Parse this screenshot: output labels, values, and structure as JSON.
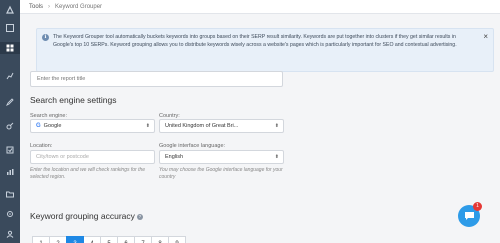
{
  "breadcrumb": {
    "root": "Tools",
    "separator": "›",
    "current": "Keyword Grouper"
  },
  "info": {
    "text": "The Keyword Grouper tool automatically buckets keywords into groups based on their SERP result similarity. Keywords are put together into clusters if they get similar results in Google's top 10 SERPs. Keyword grouping allows you to distribute keywords wisely across a website's pages which is particularly important for SEO and contextual advertising.",
    "close": "×",
    "icon_char": "i"
  },
  "report_title": {
    "placeholder": "Enter the report title"
  },
  "search_engine_settings": {
    "heading": "Search engine settings",
    "engine_label": "Search engine:",
    "engine_value": "Google",
    "country_label": "Country:",
    "country_value": "United Kingdom of Great Bri...",
    "location_label": "Location:",
    "location_placeholder": "City/town or postcode",
    "location_hint": "Enter the location and we will check rankings for the selected region.",
    "language_label": "Google interface language:",
    "language_value": "English",
    "language_hint": "You may choose the Google interface language for your country"
  },
  "accuracy": {
    "heading": "Keyword grouping accuracy",
    "options": [
      "1",
      "2",
      "3",
      "4",
      "5",
      "6",
      "7",
      "8",
      "9"
    ],
    "selected": "3"
  },
  "chat": {
    "badge": "1"
  },
  "colors": {
    "accent": "#1e88e5",
    "sidebar": "#3a4a5c",
    "chat": "#2d9be8"
  }
}
